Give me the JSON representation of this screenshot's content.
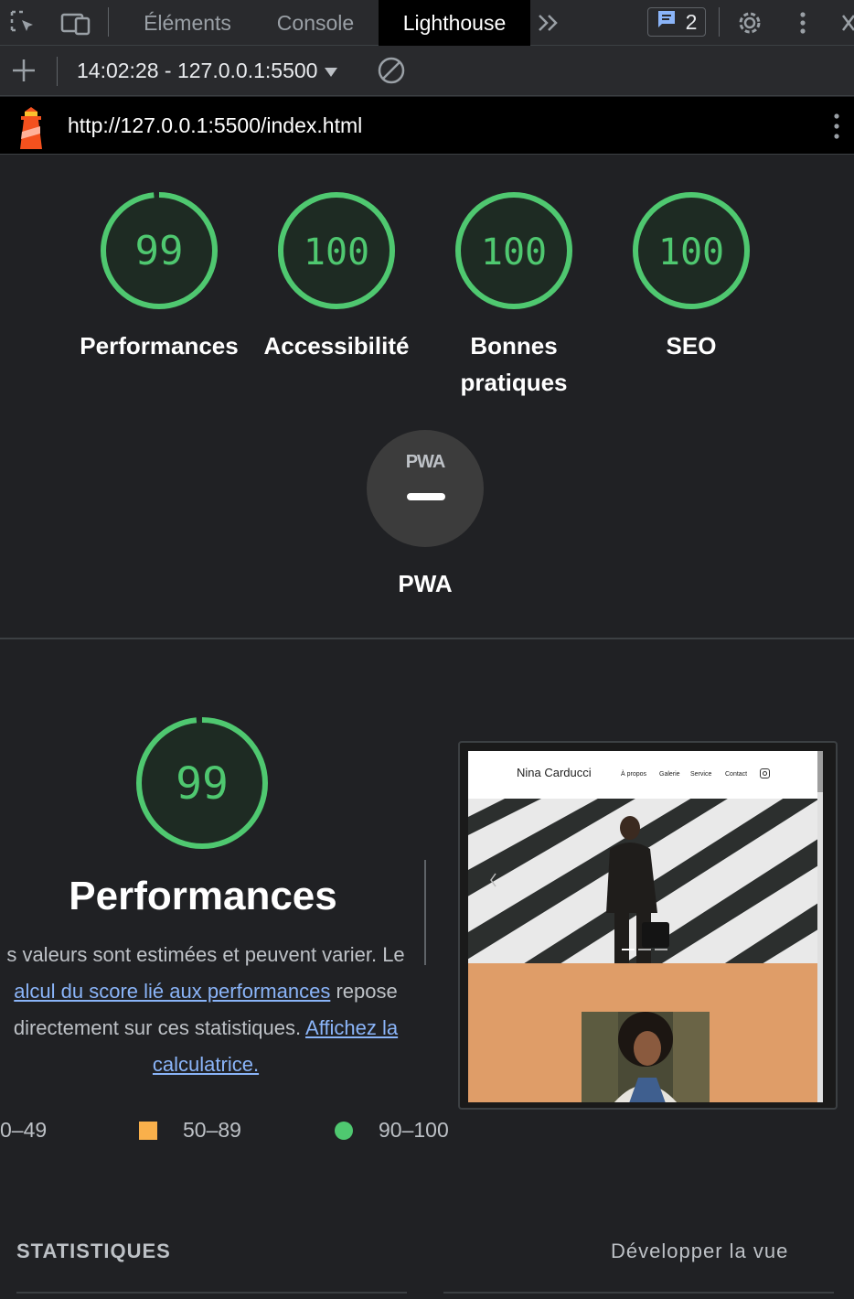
{
  "devtools": {
    "tabs": [
      {
        "label": "Éléments",
        "active": false
      },
      {
        "label": "Console",
        "active": false
      },
      {
        "label": "Lighthouse",
        "active": true
      }
    ],
    "issues_count": "2",
    "icons": [
      "inspect-icon",
      "device-toolbar-icon",
      "more-tabs-icon",
      "issues-icon",
      "gear-icon",
      "kebab-icon",
      "close-icon"
    ]
  },
  "toolbar": {
    "report_select": "14:02:28 - 127.0.0.1:5500",
    "icons": [
      "plus-icon",
      "dropdown-caret-icon",
      "clear-icon"
    ]
  },
  "urlbar": {
    "url": "http://127.0.0.1:5500/index.html",
    "icons": [
      "lighthouse-logo-icon",
      "kebab-icon"
    ]
  },
  "scores": [
    {
      "label": "Performances",
      "value": 99
    },
    {
      "label": "Accessibilité",
      "value": 100
    },
    {
      "label": "Bonnes pratiques",
      "value": 100
    },
    {
      "label": "SEO",
      "value": 100
    }
  ],
  "pwa": {
    "badge": "PWA",
    "label": "PWA"
  },
  "performance": {
    "score": 99,
    "title": "Performances",
    "desc_start": "s valeurs sont estimées et peuvent varier. Le",
    "link_score": "alcul du score lié aux performances",
    "desc_mid_1": "repose",
    "desc_mid_2": "directement sur ces statistiques.",
    "link_calc_1": "Affichez la",
    "link_calc_2": "calculatrice."
  },
  "legend": [
    {
      "range": "0–49",
      "shape": "triangle",
      "color": "#ff4e42"
    },
    {
      "range": "50–89",
      "shape": "square",
      "color": "#ffa400"
    },
    {
      "range": "90–100",
      "shape": "circle",
      "color": "#0cce6b"
    }
  ],
  "screenshot": {
    "site_name": "Nina Carducci",
    "nav": [
      "À propos",
      "Galerie",
      "Service",
      "Contact"
    ],
    "icons": [
      "instagram-icon"
    ]
  },
  "stats": {
    "label": "STATISTIQUES",
    "expand": "Développer la vue"
  },
  "colors": {
    "score_green": "#0cce6b",
    "bg": "#202124",
    "link": "#8ab4f8"
  }
}
